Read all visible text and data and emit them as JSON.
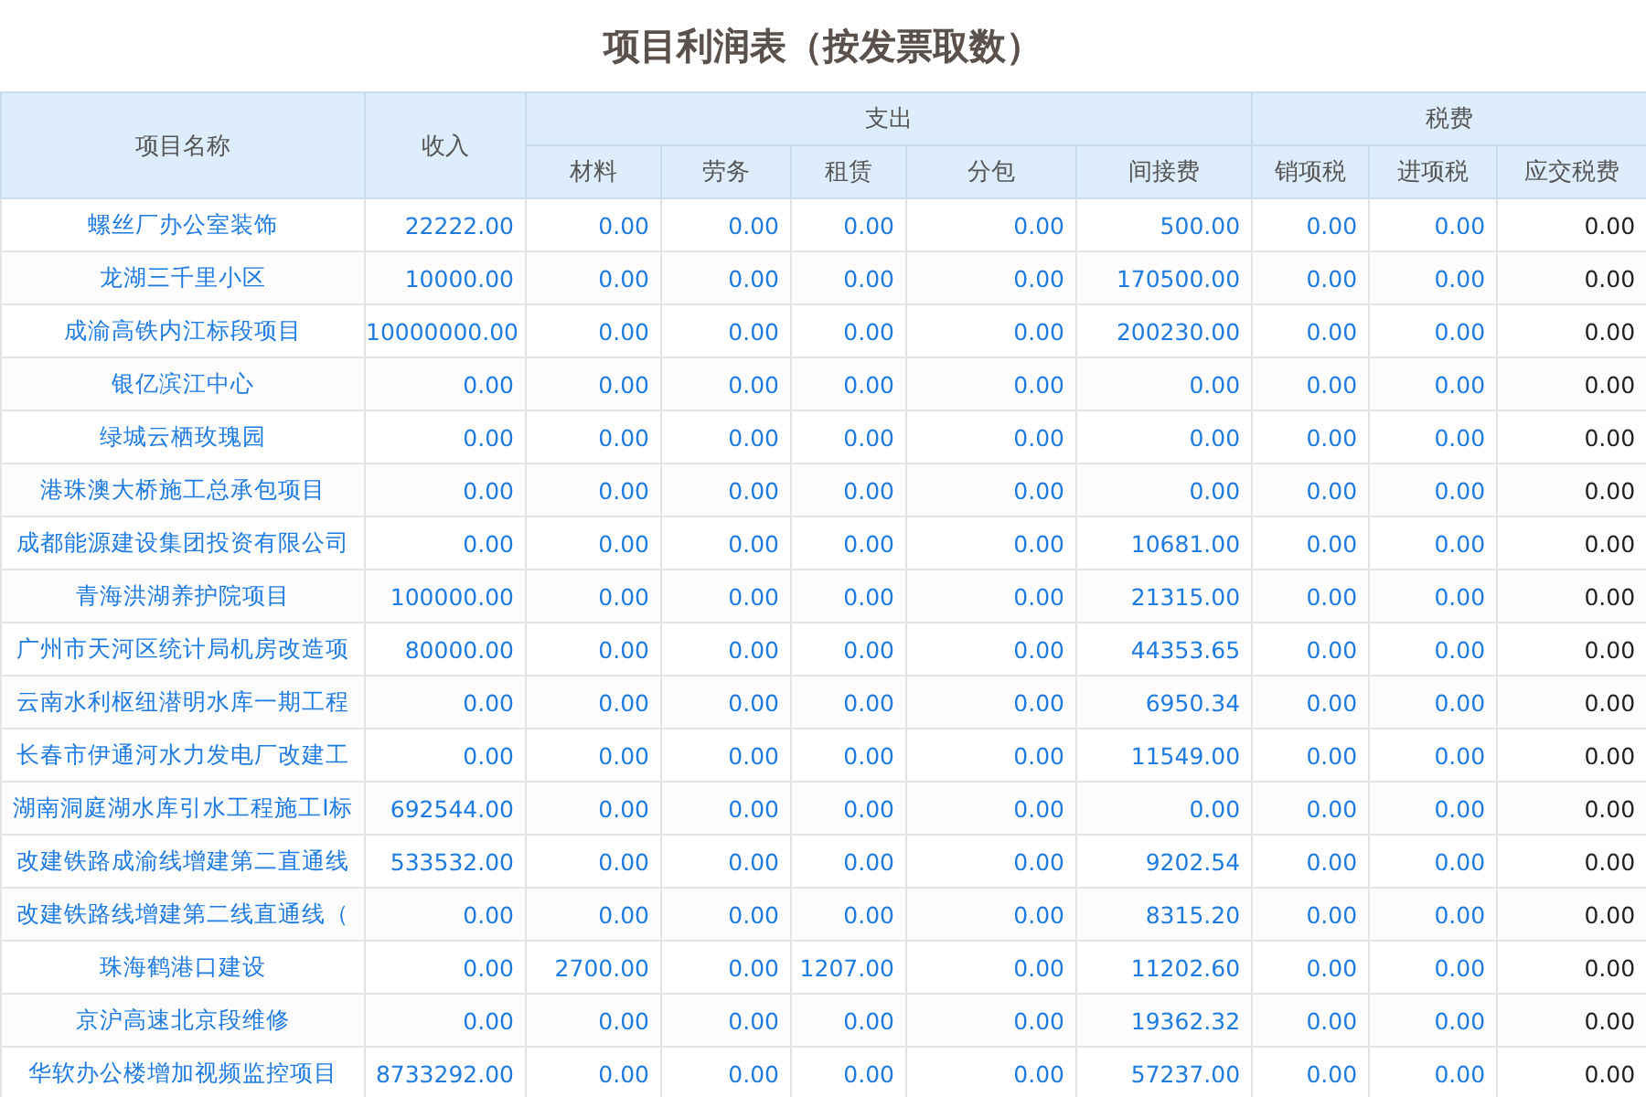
{
  "title": "项目利润表（按发票取数）",
  "header_groups": [
    {
      "label": "项目名称"
    },
    {
      "label": "收入"
    },
    {
      "label": "支出",
      "columns": [
        "材料",
        "劳务",
        "租赁",
        "分包",
        "间接费"
      ]
    },
    {
      "label": "税费",
      "columns": [
        "销项税",
        "进项税",
        "应交税费"
      ]
    }
  ],
  "rows": [
    {
      "name": "螺丝厂办公室装饰",
      "values": [
        "22222.00",
        "0.00",
        "0.00",
        "0.00",
        "0.00",
        "500.00",
        "0.00",
        "0.00",
        "0.00"
      ]
    },
    {
      "name": "龙湖三千里小区",
      "values": [
        "10000.00",
        "0.00",
        "0.00",
        "0.00",
        "0.00",
        "170500.00",
        "0.00",
        "0.00",
        "0.00"
      ]
    },
    {
      "name": "成渝高铁内江标段项目",
      "values": [
        "10000000.00",
        "0.00",
        "0.00",
        "0.00",
        "0.00",
        "200230.00",
        "0.00",
        "0.00",
        "0.00"
      ]
    },
    {
      "name": "银亿滨江中心",
      "values": [
        "0.00",
        "0.00",
        "0.00",
        "0.00",
        "0.00",
        "0.00",
        "0.00",
        "0.00",
        "0.00"
      ]
    },
    {
      "name": "绿城云栖玫瑰园",
      "values": [
        "0.00",
        "0.00",
        "0.00",
        "0.00",
        "0.00",
        "0.00",
        "0.00",
        "0.00",
        "0.00"
      ]
    },
    {
      "name": "港珠澳大桥施工总承包项目",
      "values": [
        "0.00",
        "0.00",
        "0.00",
        "0.00",
        "0.00",
        "0.00",
        "0.00",
        "0.00",
        "0.00"
      ]
    },
    {
      "name": "成都能源建设集团投资有限公司",
      "values": [
        "0.00",
        "0.00",
        "0.00",
        "0.00",
        "0.00",
        "10681.00",
        "0.00",
        "0.00",
        "0.00"
      ]
    },
    {
      "name": "青海洪湖养护院项目",
      "values": [
        "100000.00",
        "0.00",
        "0.00",
        "0.00",
        "0.00",
        "21315.00",
        "0.00",
        "0.00",
        "0.00"
      ]
    },
    {
      "name": "广州市天河区统计局机房改造项",
      "values": [
        "80000.00",
        "0.00",
        "0.00",
        "0.00",
        "0.00",
        "44353.65",
        "0.00",
        "0.00",
        "0.00"
      ]
    },
    {
      "name": "云南水利枢纽潜明水库一期工程",
      "values": [
        "0.00",
        "0.00",
        "0.00",
        "0.00",
        "0.00",
        "6950.34",
        "0.00",
        "0.00",
        "0.00"
      ]
    },
    {
      "name": "长春市伊通河水力发电厂改建工",
      "values": [
        "0.00",
        "0.00",
        "0.00",
        "0.00",
        "0.00",
        "11549.00",
        "0.00",
        "0.00",
        "0.00"
      ]
    },
    {
      "name": "湖南洞庭湖水库引水工程施工I标",
      "values": [
        "692544.00",
        "0.00",
        "0.00",
        "0.00",
        "0.00",
        "0.00",
        "0.00",
        "0.00",
        "0.00"
      ]
    },
    {
      "name": "改建铁路成渝线增建第二直通线",
      "values": [
        "533532.00",
        "0.00",
        "0.00",
        "0.00",
        "0.00",
        "9202.54",
        "0.00",
        "0.00",
        "0.00"
      ]
    },
    {
      "name": "改建铁路线增建第二线直通线（",
      "values": [
        "0.00",
        "0.00",
        "0.00",
        "0.00",
        "0.00",
        "8315.20",
        "0.00",
        "0.00",
        "0.00"
      ]
    },
    {
      "name": "珠海鹤港口建设",
      "values": [
        "0.00",
        "2700.00",
        "0.00",
        "1207.00",
        "0.00",
        "11202.60",
        "0.00",
        "0.00",
        "0.00"
      ]
    },
    {
      "name": "京沪高速北京段维修",
      "values": [
        "0.00",
        "0.00",
        "0.00",
        "0.00",
        "0.00",
        "19362.32",
        "0.00",
        "0.00",
        "0.00"
      ]
    },
    {
      "name": "华软办公楼增加视频监控项目",
      "values": [
        "8733292.00",
        "0.00",
        "0.00",
        "0.00",
        "0.00",
        "57237.00",
        "0.00",
        "0.00",
        "0.00"
      ]
    }
  ]
}
